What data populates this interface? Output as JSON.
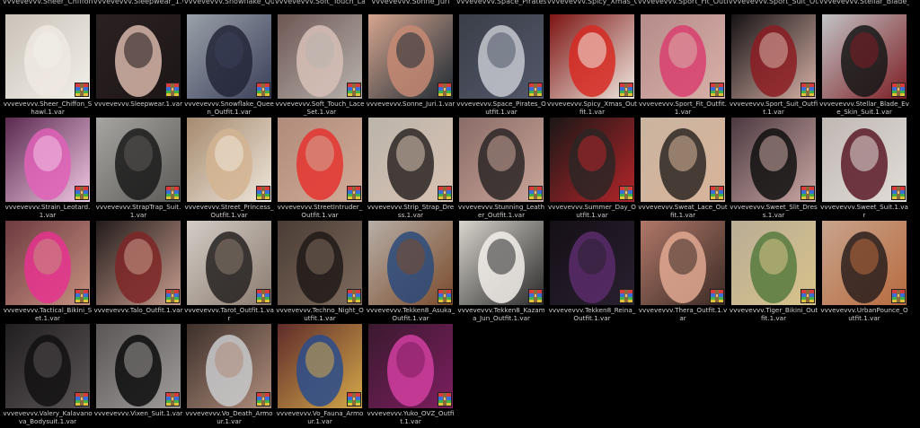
{
  "top_fragments": [
    "vvvevevvv.Sheer_Chiffon_S",
    "vvvevevvv.Sleepwear_1.var",
    "vvvevevvv.Snowflake_Queen",
    "vvvevevvv.Soft_Touch_Lace",
    "vvvevevvv.Sonne_Juri",
    "vvvevevvv.Space_Pirates_O",
    "vvvevevvv.Spicy_Xmas_Out",
    "vvvevevvv.Sport_Fit_Outfit",
    "vvvevevvv.Sport_Suit_Outfit",
    "vvvevevvv.Stellar_Blade_Ev"
  ],
  "icon": "winrar-archive-icon",
  "files": [
    {
      "name": "vvvevevvv.Sheer_Chiffon_Shawl.1.var",
      "bg": "#c9c2b8",
      "fg": "#efe9e2",
      "accent": "#f3f0ea"
    },
    {
      "name": "vvvevevvv.Sleepwear.1.var",
      "bg": "#2a2122",
      "fg": "#d8b7aa",
      "accent": "#1d1616"
    },
    {
      "name": "vvvevevvv.Snowflake_Queen_Outfit.1.var",
      "bg": "#9aa1a8",
      "fg": "#222637",
      "accent": "#3a3f5a"
    },
    {
      "name": "vvvevevvv.Soft_Touch_Lace_Set.1.var",
      "bg": "#6e5754",
      "fg": "#d7c1b8",
      "accent": "#b9b3ad"
    },
    {
      "name": "vvvevevvv.Sonne_Juri.1.var",
      "bg": "#d6a58f",
      "fg": "#c58a73",
      "accent": "#1e2a34"
    },
    {
      "name": "vvvevevvv.Space_Pirates_Outfit.1.var",
      "bg": "#3b3f48",
      "fg": "#c5c8cf",
      "accent": "#52576a"
    },
    {
      "name": "vvvevevvv.Spicy_Xmas_Outfit.1.var",
      "bg": "#7c1413",
      "fg": "#d62a22",
      "accent": "#f0e9e0"
    },
    {
      "name": "vvvevevvv.Sport_Fit_Outfit.1.var",
      "bg": "#b58b8a",
      "fg": "#d83e6f",
      "accent": "#d9b1a8"
    },
    {
      "name": "vvvevevvv.Sport_Suit_Outfit.1.var",
      "bg": "#161214",
      "fg": "#8b1c22",
      "accent": "#d5b0a5"
    },
    {
      "name": "vvvevevvv.Stellar_Blade_Eve_Skin_Suit.1.var",
      "bg": "#c1c3c5",
      "fg": "#161616",
      "accent": "#7c1e24"
    },
    {
      "name": "vvvevevvv.Strain_Leotard.1.var",
      "bg": "#5a2a4f",
      "fg": "#e060b8",
      "accent": "#f1c6e3"
    },
    {
      "name": "vvvevevvv.StrapTrap_Suit.1.var",
      "bg": "#a7a5a2",
      "fg": "#1a1a1a",
      "accent": "#5c5a57"
    },
    {
      "name": "vvvevevvv.Street_Princess_Outfit.1.var",
      "bg": "#a58a6f",
      "fg": "#d2b492",
      "accent": "#efe6da"
    },
    {
      "name": "vvvevevvv.StreetIntruder_Outfit.1.var",
      "bg": "#b08b7b",
      "fg": "#e5332f",
      "accent": "#d2ab98"
    },
    {
      "name": "vvvevevvv.Strip_Strap_Dress.1.var",
      "bg": "#bbb4aa",
      "fg": "#2c2624",
      "accent": "#d8c2b2"
    },
    {
      "name": "vvvevevvv.Stunning_Leather_Outfit.1.var",
      "bg": "#8a6c67",
      "fg": "#2a2626",
      "accent": "#caa59a"
    },
    {
      "name": "vvvevevvv.Summer_Day_Outfit.1.var",
      "bg": "#1a1716",
      "fg": "#2b2624",
      "accent": "#b4252a"
    },
    {
      "name": "vvvevevvv.Sweat_Lace_Outfit.1.var",
      "bg": "#c9b49f",
      "fg": "#2d2723",
      "accent": "#d9b49b"
    },
    {
      "name": "vvvevevvv.Sweet_Slit_Dress.1.var",
      "bg": "#4b3940",
      "fg": "#111111",
      "accent": "#caa7a3"
    },
    {
      "name": "vvvevevvv.Sweet_Suit.1.var",
      "bg": "#bfb7b2",
      "fg": "#5a1a26",
      "accent": "#e2ddd8"
    },
    {
      "name": "vvvevevvv.Tactical_Bikini_Set.1.var",
      "bg": "#6d3a40",
      "fg": "#e6338f",
      "accent": "#c79180"
    },
    {
      "name": "vvvevevvv.Talo_Outfit.1.var",
      "bg": "#221b1b",
      "fg": "#7c2626",
      "accent": "#c89c8d"
    },
    {
      "name": "vvvevevvv.Tarot_Outfit.1.var",
      "bg": "#d3cdc6",
      "fg": "#262221",
      "accent": "#8a7a6e"
    },
    {
      "name": "vvvevevvv.Techno_Night_Outfit.1.var",
      "bg": "#4a3c35",
      "fg": "#1f1916",
      "accent": "#7d6b5c"
    },
    {
      "name": "vvvevevvv.Tekken8_Asuka_Outfit.1.var",
      "bg": "#b7aea6",
      "fg": "#2c4a7a",
      "accent": "#7a4b2c"
    },
    {
      "name": "vvvevevvv.Tekken8_Kazama_Jun_Outfit.1.var",
      "bg": "#d8d4cd",
      "fg": "#f2efea",
      "accent": "#2a2a2a"
    },
    {
      "name": "vvvevevvv.Tekken8_Reina_Outfit.1.var",
      "bg": "#150f16",
      "fg": "#5b2c6b",
      "accent": "#2a2030"
    },
    {
      "name": "vvvevevvv.Thera_Outfit.1.var",
      "bg": "#b07869",
      "fg": "#e0a892",
      "accent": "#3a2a24"
    },
    {
      "name": "vvvevevvv.Tiger_Bikini_Outfit.1.var",
      "bg": "#b9ac96",
      "fg": "#567a3e",
      "accent": "#d8c38a"
    },
    {
      "name": "vvvevevvv.UrbanPounce_Outfit.1.var",
      "bg": "#c7a48c",
      "fg": "#2a1f1c",
      "accent": "#b86a3e"
    },
    {
      "name": "vvvevevvv.Valery_Kalavanova_Bodysuit.1.var",
      "bg": "#221f20",
      "fg": "#121112",
      "accent": "#5a5455"
    },
    {
      "name": "vvvevevvv.Vixen_Suit.1.var",
      "bg": "#5a5655",
      "fg": "#0c0c0c",
      "accent": "#a09c9b"
    },
    {
      "name": "vvvevevvv.Vo_Death_Armour.1.var",
      "bg": "#3c2f2a",
      "fg": "#c9cacd",
      "accent": "#b08d7c"
    },
    {
      "name": "vvvevevvv.Vo_Fauna_Armour.1.var",
      "bg": "#5f2b2a",
      "fg": "#2a4c8c",
      "accent": "#d4a84a"
    },
    {
      "name": "vvvevevvv.Yuko_OVZ_Outfit.1.var",
      "bg": "#3a1a2f",
      "fg": "#d13ea0",
      "accent": "#7c1e5f"
    }
  ]
}
